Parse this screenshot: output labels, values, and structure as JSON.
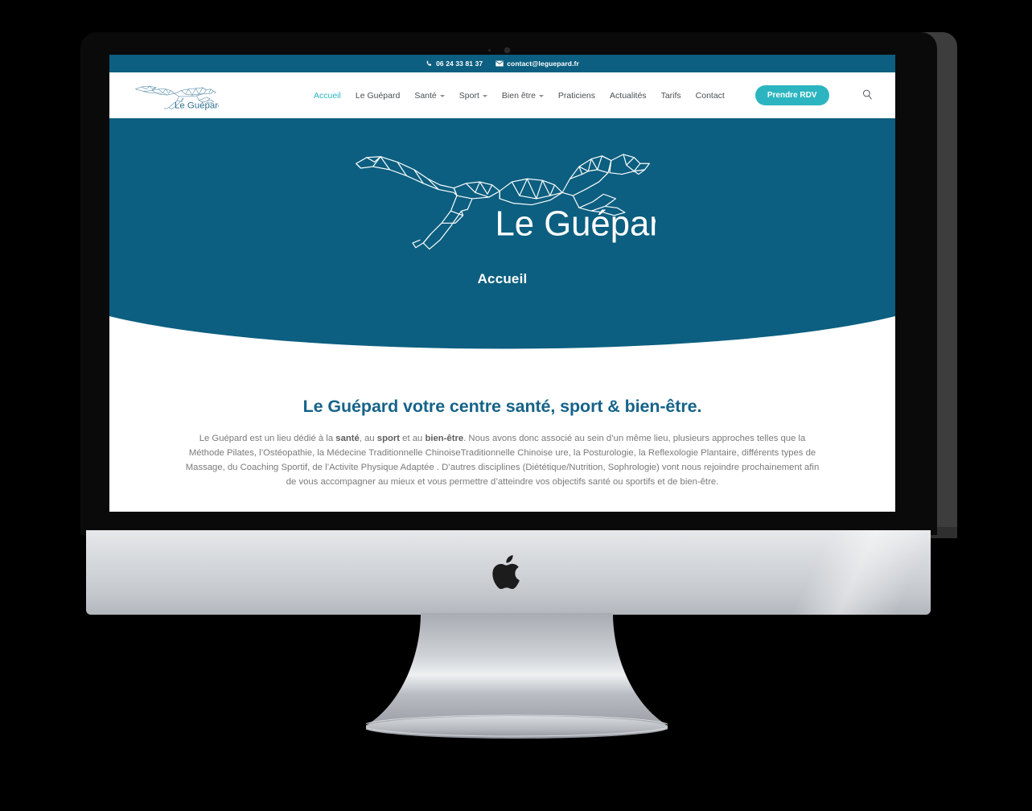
{
  "device": {
    "kind": "imac-desktop-mockup",
    "brand_mark": "apple-logo"
  },
  "site": {
    "topbar": {
      "phone_icon": "phone-icon",
      "phone": "06 24 33 81 37",
      "email_icon": "envelope-icon",
      "email": "contact@leguepard.fr"
    },
    "logo": {
      "icon": "cheetah-polygon-logo",
      "text": "Le Guépard"
    },
    "nav": {
      "items": [
        {
          "label": "Accueil",
          "active": true,
          "has_dropdown": false
        },
        {
          "label": "Le Guépard",
          "active": false,
          "has_dropdown": false
        },
        {
          "label": "Santé",
          "active": false,
          "has_dropdown": true
        },
        {
          "label": "Sport",
          "active": false,
          "has_dropdown": true
        },
        {
          "label": "Bien être",
          "active": false,
          "has_dropdown": true
        },
        {
          "label": "Praticiens",
          "active": false,
          "has_dropdown": false
        },
        {
          "label": "Actualités",
          "active": false,
          "has_dropdown": false
        },
        {
          "label": "Tarifs",
          "active": false,
          "has_dropdown": false
        },
        {
          "label": "Contact",
          "active": false,
          "has_dropdown": false
        }
      ],
      "cta_label": "Prendre RDV",
      "search_icon": "search-icon"
    },
    "hero": {
      "logo_icon": "cheetah-polygon-logo",
      "logo_text": "Le Guépard",
      "page_title": "Accueil"
    },
    "main": {
      "heading": "Le Guépard votre centre santé, sport & bien-être.",
      "paragraph_parts": [
        {
          "text": "Le Guépard est un lieu dédié à la ",
          "bold": false
        },
        {
          "text": "santé",
          "bold": true
        },
        {
          "text": ", au ",
          "bold": false
        },
        {
          "text": "sport",
          "bold": true
        },
        {
          "text": " et au ",
          "bold": false
        },
        {
          "text": "bien-être",
          "bold": true
        },
        {
          "text": ". Nous avons donc associé au sein d’un même lieu, plusieurs approches telles que la Méthode Pilates, l’Ostéopathie, la Médecine Traditionnelle ChinoiseTraditionnelle Chinoise ure, la Posturologie, la Reflexologie Plantaire, différents types de Massage, du Coaching Sportif, de l’Activite Physique Adaptée . D’autres disciplines (Diététique/Nutrition, Sophrologie) vont nous rejoindre prochainement afin de vous accompagner au mieux et vous permettre d’atteindre vos objectifs santé ou sportifs et de bien-être.",
          "bold": false
        }
      ]
    },
    "colors": {
      "brand_dark_teal": "#0c5f80",
      "brand_light_teal": "#2cb5c0",
      "heading_blue": "#166389",
      "body_text": "#7a7a7a",
      "page_background": "#ffffff",
      "canvas_background": "#000000"
    }
  }
}
